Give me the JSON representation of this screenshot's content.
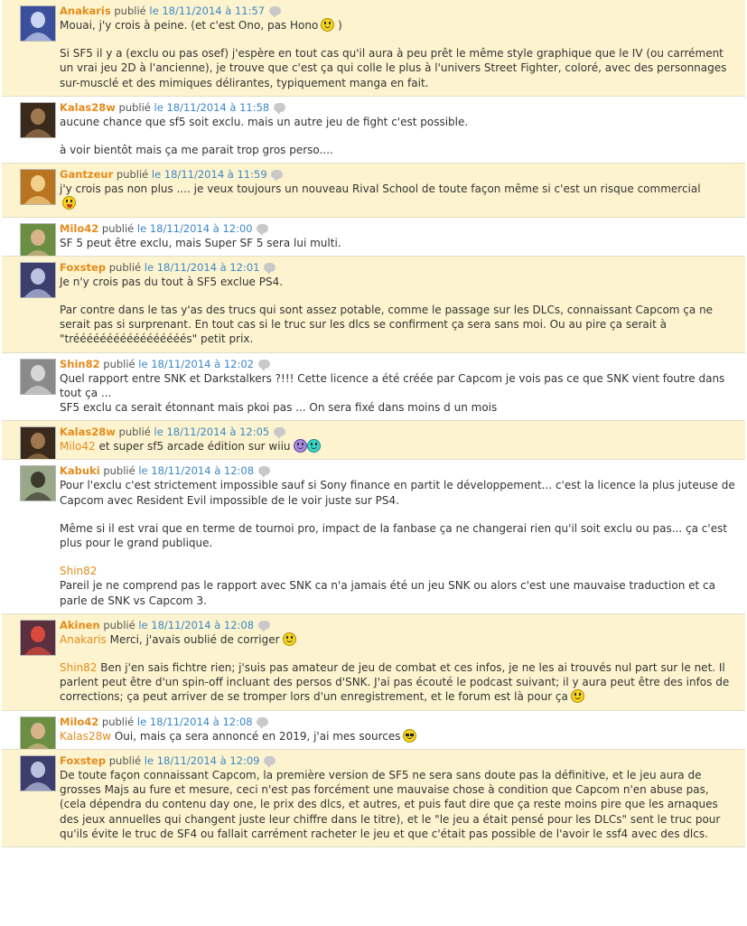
{
  "published_label": "publié",
  "comments": [
    {
      "author": "Anakaris",
      "date": "le 18/11/2014 à 11:57",
      "highlight": true,
      "avatar": {
        "name": "anakaris-avatar",
        "bg": "#3b4f9a",
        "fg": "#c9d5f2"
      },
      "paragraphs": [
        {
          "text": "Mouai, j'y crois à peine. (et c'est Ono, pas Hono",
          "suffix": " )",
          "smiley": "wink"
        },
        {
          "text": "Si SF5 il y a (exclu ou pas osef) j'espère en tout cas qu'il aura à peu prêt le même style graphique que le IV (ou carrément un vrai jeu 2D à l'ancienne), je trouve que c'est ça qui colle le plus à l'univers Street Fighter, coloré, avec des personnages sur-musclé et des mimiques délirantes, typiquement manga en fait."
        }
      ]
    },
    {
      "author": "Kalas28w",
      "date": "le 18/11/2014 à 11:58",
      "highlight": false,
      "avatar": {
        "name": "kalas28w-avatar",
        "bg": "#3a2a1c",
        "fg": "#a07850"
      },
      "paragraphs": [
        {
          "text": "aucune chance que sf5 soit exclu. mais un autre jeu de fight c'est possible."
        },
        {
          "text": "à voir bientôt mais ça me parait trop gros perso...."
        }
      ]
    },
    {
      "author": "Gantzeur",
      "date": "le 18/11/2014 à 11:59",
      "highlight": true,
      "avatar": {
        "name": "gantzeur-avatar",
        "bg": "#b8741e",
        "fg": "#f3d08a"
      },
      "paragraphs": [
        {
          "text": "j'y crois pas non plus .... je veux toujours un nouveau Rival School de toute façon même si c'est un risque commercial",
          "smiley": "laugh",
          "smiley_break": true
        }
      ]
    },
    {
      "author": "Milo42",
      "date": "le 18/11/2014 à 12:00",
      "highlight": false,
      "avatar": {
        "name": "milo42-avatar",
        "bg": "#6a8f43",
        "fg": "#d8b48a"
      },
      "paragraphs": [
        {
          "text": "SF 5 peut être exclu, mais Super SF 5 sera lui multi."
        }
      ]
    },
    {
      "author": "Foxstep",
      "date": "le 18/11/2014 à 12:01",
      "highlight": true,
      "avatar": {
        "name": "foxstep-avatar",
        "bg": "#3c3f6e",
        "fg": "#b9c2de"
      },
      "paragraphs": [
        {
          "text": "Je n'y crois pas du tout à SF5 exclue PS4."
        },
        {
          "text": "Par contre dans le tas y'as des trucs qui sont assez potable, comme le passage sur les DLCs, connaissant Capcom ça ne serait pas si surprenant. En tout cas si le truc sur les dlcs se confirment ça sera sans moi. Ou au pire ça serait à \"trééééééééééééééééés\" petit prix."
        }
      ]
    },
    {
      "author": "Shin82",
      "date": "le 18/11/2014 à 12:02",
      "highlight": false,
      "avatar": {
        "name": "shin82-avatar",
        "bg": "#8a8a8a",
        "fg": "#d6d6d6"
      },
      "paragraphs": [
        {
          "text": "Quel rapport entre SNK et Darkstalkers ?!!! Cette licence a été créée par Capcom je vois pas ce que SNK vient foutre dans tout ça ...",
          "join_next": true
        },
        {
          "text": "SF5 exclu ca serait étonnant mais pkoi pas ... On sera fixé dans moins d un mois"
        }
      ]
    },
    {
      "author": "Kalas28w",
      "date": "le 18/11/2014 à 12:05",
      "highlight": true,
      "avatar": {
        "name": "kalas28w-avatar-2",
        "bg": "#3a2a1c",
        "fg": "#a07850"
      },
      "paragraphs": [
        {
          "mention": "Milo42",
          "text": " et super sf5 arcade édition sur wiiu",
          "smileys": [
            "purple",
            "teal"
          ]
        }
      ]
    },
    {
      "author": "Kabuki",
      "date": "le 18/11/2014 à 12:08",
      "highlight": false,
      "avatar": {
        "name": "kabuki-avatar",
        "bg": "#9aa889",
        "fg": "#3b3a2c"
      },
      "paragraphs": [
        {
          "text": "Pour l'exclu c'est strictement impossible sauf si Sony finance en partit le développement... c'est la licence la plus juteuse de Capcom avec Resident Evil impossible de le voir juste sur PS4."
        },
        {
          "text": "Même si il est vrai que en terme de tournoi pro, impact de la fanbase ça ne changerai rien qu'il soit exclu ou pas... ça c'est plus pour le grand publique."
        },
        {
          "mention": "Shin82",
          "text": "",
          "join_next": true
        },
        {
          "text": "Pareil je ne comprend pas le rapport avec SNK ca n'a jamais été un jeu SNK ou alors c'est une mauvaise traduction et ca parle de SNK vs Capcom 3."
        }
      ]
    },
    {
      "author": "Akinen",
      "date": "le 18/11/2014 à 12:08",
      "highlight": true,
      "avatar": {
        "name": "akinen-avatar",
        "bg": "#5a2f3e",
        "fg": "#d94a3c"
      },
      "paragraphs": [
        {
          "mention": "Anakaris",
          "text": " Merci, j'avais oublié de corriger",
          "smiley": "wink"
        },
        {
          "mention": "Shin82",
          "text": " Ben j'en sais fichtre rien; j'suis pas amateur de jeu de combat et ces infos, je ne les ai trouvés nul part sur le net. Il parlent peut être d'un spin-off incluant des persos d'SNK. J'ai pas écouté le podcast suivant; il y aura peut être des infos de corrections; ça peut arriver de se tromper lors d'un enregistrement, et le forum est là pour ça",
          "smiley": "wink"
        }
      ]
    },
    {
      "author": "Milo42",
      "date": "le 18/11/2014 à 12:08",
      "highlight": false,
      "avatar": {
        "name": "milo42-avatar-2",
        "bg": "#6a8f43",
        "fg": "#d8b48a"
      },
      "paragraphs": [
        {
          "mention": "Kalas28w",
          "text": " Oui, mais ça sera annoncé en 2019, j'ai mes sources",
          "smiley": "glasses"
        }
      ]
    },
    {
      "author": "Foxstep",
      "date": "le 18/11/2014 à 12:09",
      "highlight": true,
      "avatar": {
        "name": "foxstep-avatar-2",
        "bg": "#3c3f6e",
        "fg": "#b9c2de"
      },
      "paragraphs": [
        {
          "text": "De toute façon connaissant Capcom, la première version de SF5 ne sera sans doute pas la définitive, et le jeu aura de grosses Majs au fure et mesure, ceci n'est pas forcément une mauvaise chose à condition que Capcom n'en abuse pas, (cela dépendra du contenu day one, le prix des dlcs, et autres, et puis faut dire que ça reste moins pire que les arnaques des jeux annuelles qui changent juste leur chiffre dans le titre), et le \"le jeu a était pensé pour les DLCs\" sent le truc pour qu'ils évite le truc de SF4 ou fallait carrément racheter le jeu et que c'était pas possible de l'avoir le ssf4 avec des dlcs."
        }
      ]
    }
  ]
}
